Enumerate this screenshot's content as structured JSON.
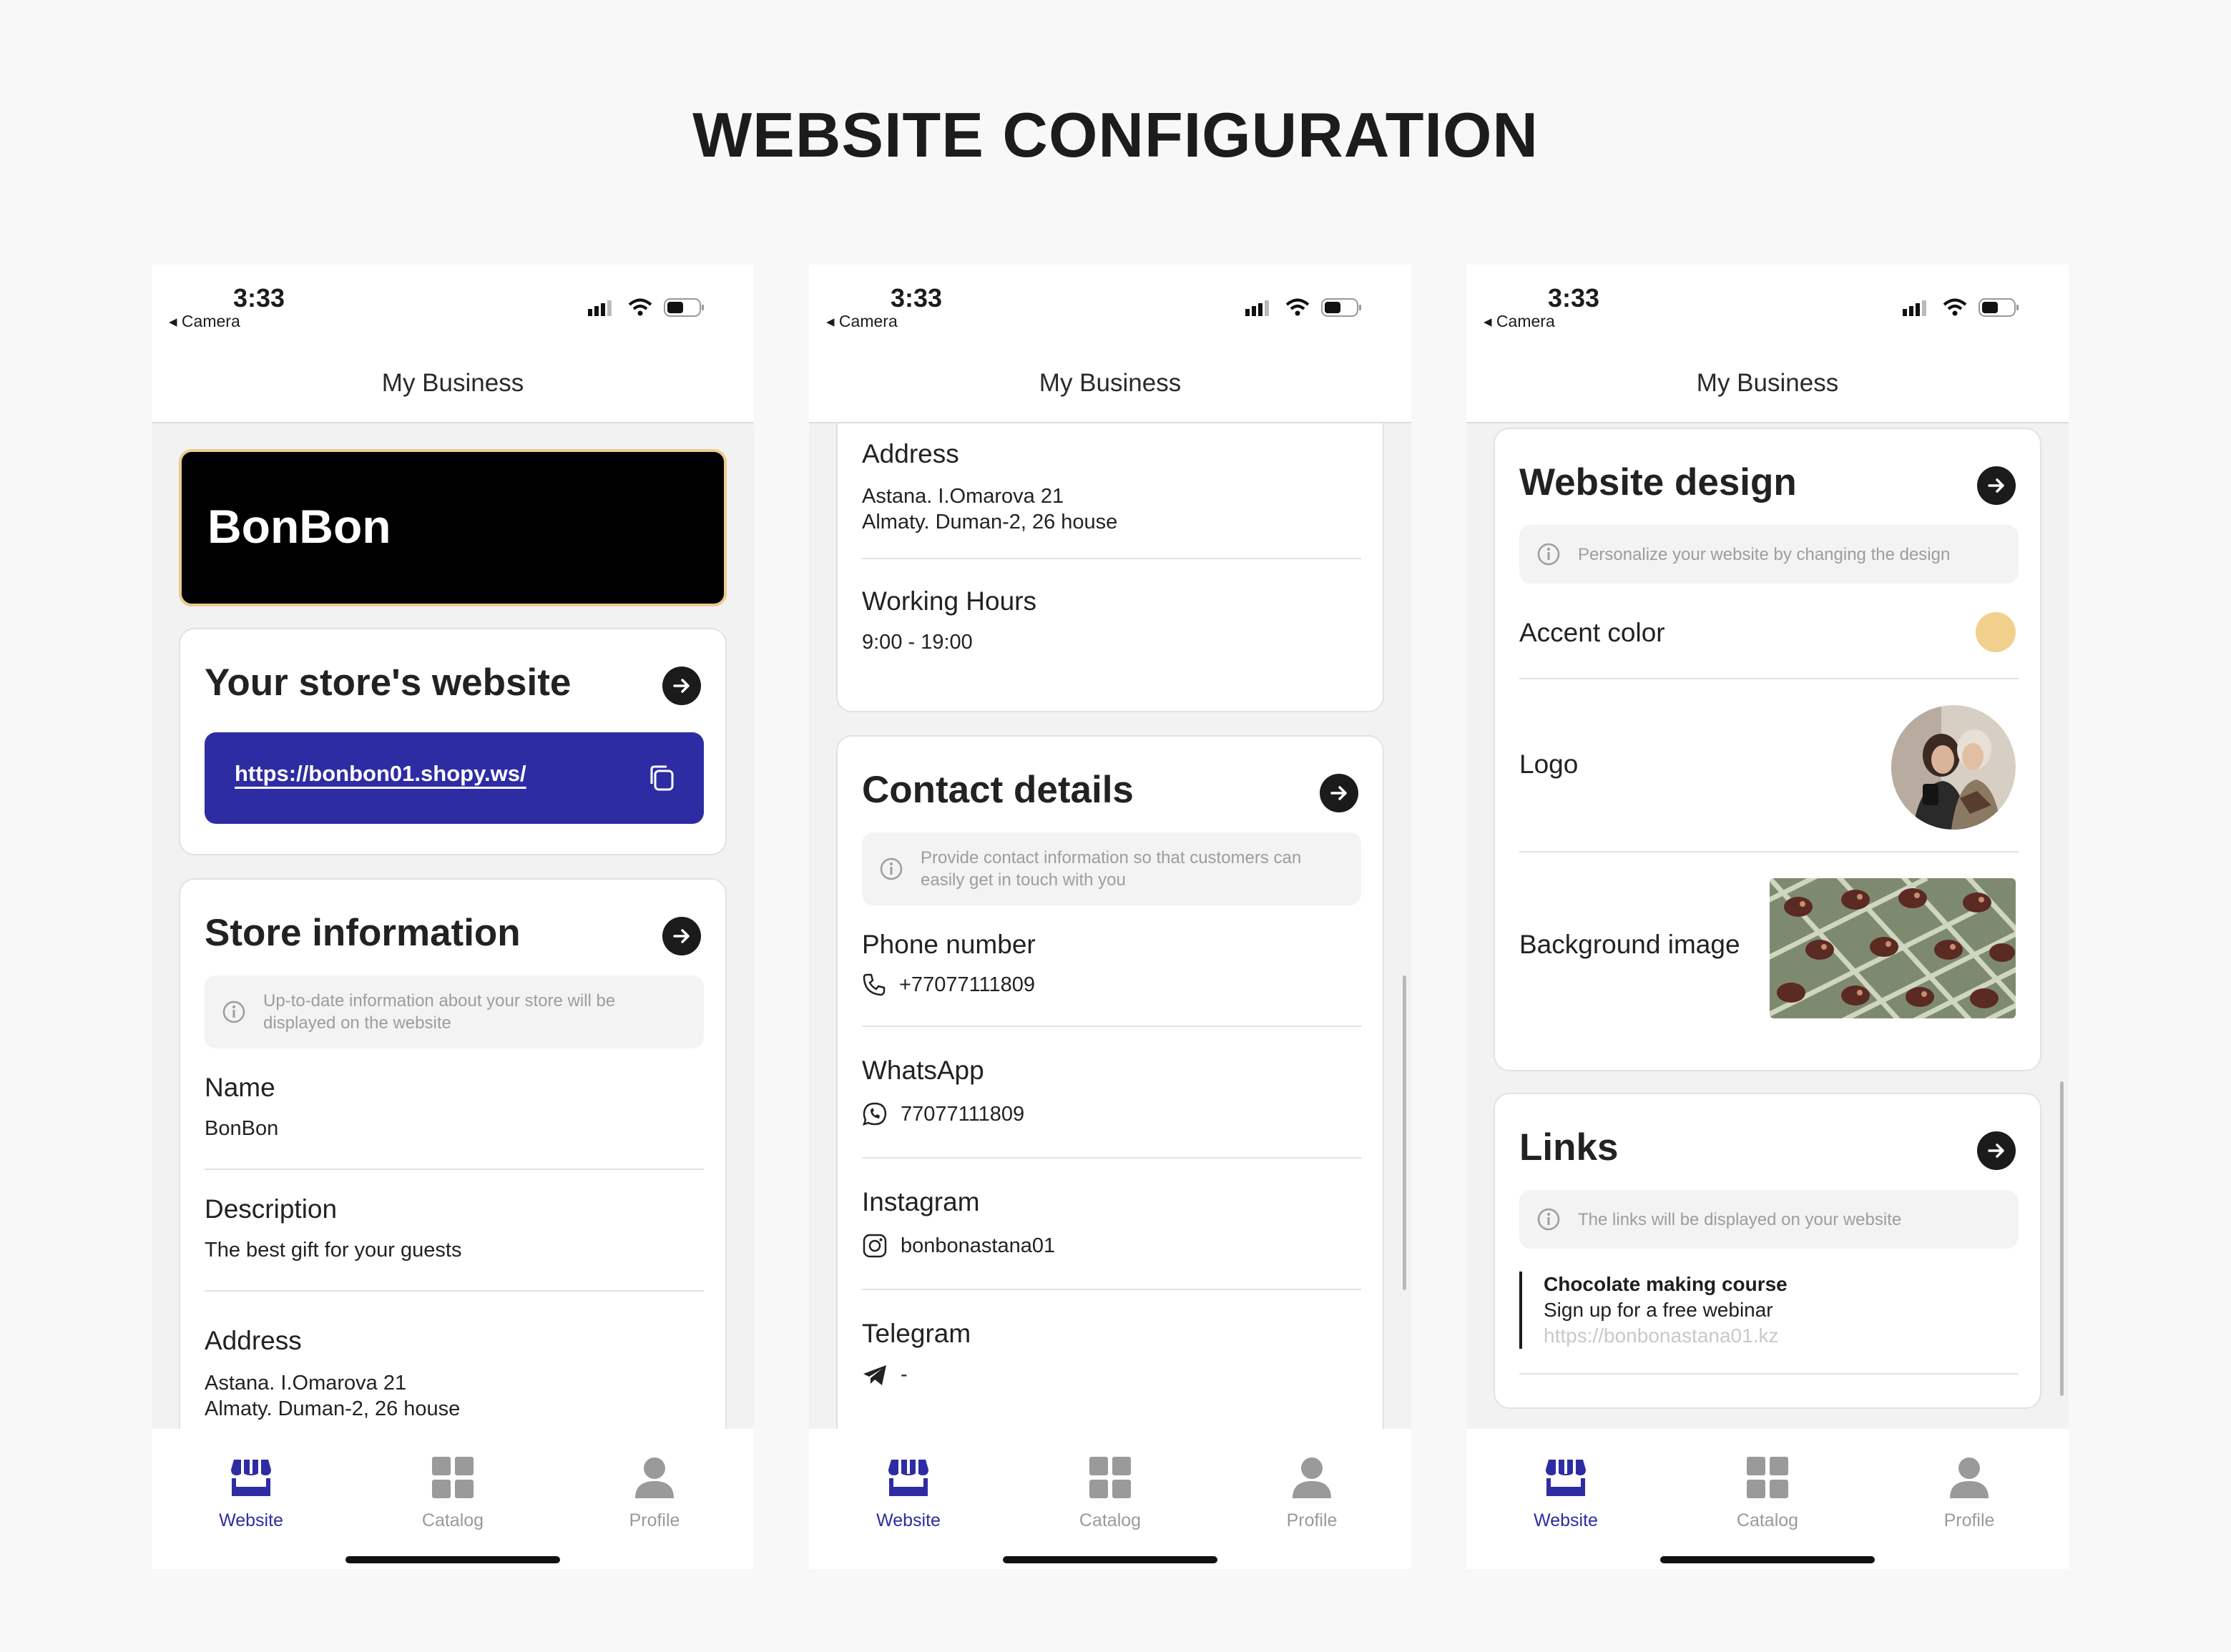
{
  "page_title": "WEBSITE CONFIGURATION",
  "status": {
    "time": "3:33",
    "back": "◂ Camera"
  },
  "nav_title": "My Business",
  "tabs": {
    "website": "Website",
    "catalog": "Catalog",
    "profile": "Profile",
    "active": "website",
    "active_color": "#2e2ca3"
  },
  "screen1": {
    "brand_name": "BonBon",
    "website_card": {
      "title": "Your store's website",
      "url": "https://bonbon01.shopy.ws/"
    },
    "store_info": {
      "title": "Store information",
      "info": "Up-to-date information about your store will be displayed on the website",
      "name_label": "Name",
      "name_value": "BonBon",
      "desc_label": "Description",
      "desc_value": "The best gift for your guests",
      "addr_label": "Address",
      "addr_line1": "Astana. I.Omarova 21",
      "addr_line2": "Almaty. Duman-2, 26 house"
    }
  },
  "screen2": {
    "addr_label": "Address",
    "addr_line1": "Astana. I.Omarova 21",
    "addr_line2": "Almaty. Duman-2, 26 house",
    "hours_label": "Working Hours",
    "hours_value": "9:00 - 19:00",
    "contact": {
      "title": "Contact details",
      "info": "Provide contact information so that customers can easily get in touch with you",
      "phone_label": "Phone number",
      "phone_value": "+77077111809",
      "whatsapp_label": "WhatsApp",
      "whatsapp_value": "77077111809",
      "instagram_label": "Instagram",
      "instagram_value": "bonbonastana01",
      "telegram_label": "Telegram",
      "telegram_value": "-"
    }
  },
  "screen3": {
    "design": {
      "title": "Website design",
      "info": "Personalize your website by changing the design",
      "accent_label": "Accent color",
      "accent_color": "#f0d08c",
      "logo_label": "Logo",
      "bg_label": "Background image"
    },
    "links": {
      "title": "Links",
      "info": "The links will be displayed on your website",
      "item_title": "Chocolate making course",
      "item_subtitle": "Sign up for a free webinar",
      "item_url": "https://bonbonastana01.kz"
    }
  }
}
